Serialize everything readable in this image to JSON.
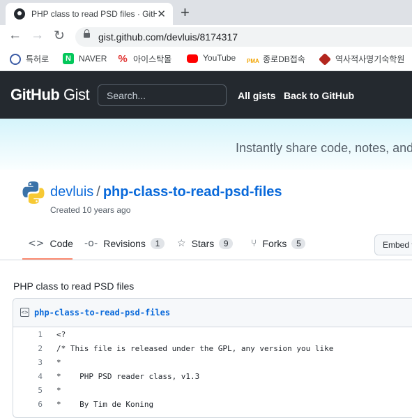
{
  "browser": {
    "tab_title": "PHP class to read PSD files · GitHub",
    "tab_close": "✕",
    "new_tab": "+",
    "url": "gist.github.com/devluis/8174317",
    "nav": {
      "back": "←",
      "forward": "→",
      "reload": "↻"
    }
  },
  "bookmarks": [
    {
      "label": "특허로",
      "icon": "patent-icon",
      "color": "#3b5ba5"
    },
    {
      "label": "NAVER",
      "icon": "naver-icon",
      "color": "#03c75a"
    },
    {
      "label": "아이스탁몰",
      "icon": "percent-icon",
      "color": "#e0312f"
    },
    {
      "label": "YouTube",
      "icon": "youtube-icon",
      "color": "#ff0000"
    },
    {
      "label": "종로DB접속",
      "icon": "pma-icon",
      "color": "#f2a400"
    },
    {
      "label": "역사적사명기숙학원",
      "icon": "academy-icon",
      "color": "#b3261e"
    }
  ],
  "header": {
    "logo_bold": "GitHub",
    "logo_light": "Gist",
    "search_placeholder": "Search...",
    "all_gists": "All gists",
    "back_to_github": "Back to GitHub"
  },
  "banner": {
    "text": "Instantly share code, notes, and snippets."
  },
  "gist": {
    "owner": "devluis",
    "separator": "/",
    "name": "php-class-to-read-psd-files",
    "created": "Created 10 years ago",
    "description": "PHP class to read PSD files",
    "filename": "php-class-to-read-psd-files"
  },
  "tabs": {
    "code": "Code",
    "revisions": "Revisions",
    "revisions_count": "1",
    "stars": "Stars",
    "stars_count": "9",
    "forks": "Forks",
    "forks_count": "5",
    "embed": "Embed ▾"
  },
  "code_lines": [
    {
      "n": "1",
      "t": "<?"
    },
    {
      "n": "2",
      "t": "/* This file is released under the GPL, any version you like"
    },
    {
      "n": "3",
      "t": "*"
    },
    {
      "n": "4",
      "t": "*    PHP PSD reader class, v1.3"
    },
    {
      "n": "5",
      "t": "*"
    },
    {
      "n": "6",
      "t": "*    By Tim de Koning"
    }
  ],
  "colors": {
    "header_bg": "#24292f",
    "link": "#0969da",
    "active_tab_underline": "#fd8c73"
  }
}
